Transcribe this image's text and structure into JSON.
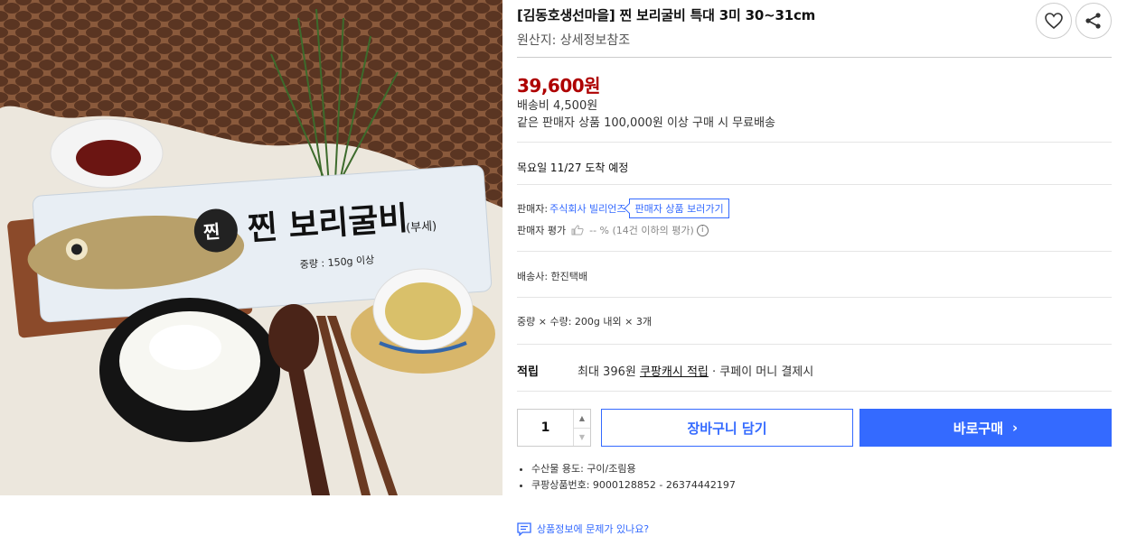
{
  "product": {
    "title": "[김동호생선마을] 찐 보리굴비 특대 3미 30~31cm",
    "origin": "원산지: 상세정보참조",
    "image_alt": "찐 보리굴비 제품 사진",
    "package_label": "찐 보리굴비",
    "package_sub": "(부세)",
    "package_weight": "중량 : 150g 이상"
  },
  "actions": {
    "wish_icon": "heart-icon",
    "share_icon": "share-icon"
  },
  "pricing": {
    "price": "39,600원",
    "shipping_fee": "배송비 4,500원",
    "free_shipping": "같은 판매자 상품 100,000원 이상 구매 시 무료배송",
    "arrival": "목요일 11/27 도착 예정"
  },
  "seller": {
    "label": "판매자:",
    "name": "주식회사 빌리언즈",
    "link": "판매자 상품 보러가기",
    "rating_label": "판매자 평가",
    "rating_value": "-- % (14건 이하의 평가)"
  },
  "delivery": {
    "courier": "배송사:  한진택배",
    "weight": "중량 × 수량: 200g 내외 × 3개"
  },
  "cash": {
    "label": "적립",
    "prefix": "최대 396원 ",
    "link": "쿠팡캐시 적립",
    "suffix": " · 쿠페이 머니 결제시"
  },
  "purchase": {
    "quantity": "1",
    "cart_label": "장바구니 담기",
    "buy_label": "바로구매"
  },
  "details": [
    "수산물 용도: 구이/조림용",
    "쿠팡상품번호: 9000128852 - 26374442197"
  ],
  "report": "상품정보에 문제가 있나요?",
  "colors": {
    "price": "#ae0000",
    "accent": "#346aff"
  }
}
